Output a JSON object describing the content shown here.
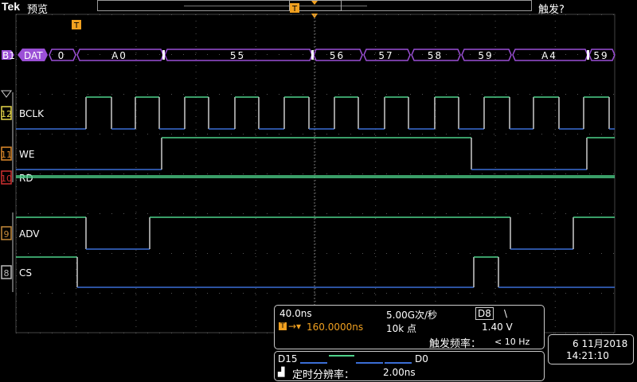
{
  "header": {
    "brand": "Tek",
    "mode": "预览",
    "trigger_status": "触发?",
    "trigger_marker": "T"
  },
  "bus": {
    "id": "B1",
    "label": "DAT",
    "symbols": [
      "0",
      "A0",
      "55",
      "56",
      "57",
      "58",
      "59",
      "A4",
      "59"
    ]
  },
  "channels": [
    {
      "num": "12",
      "name": "BCLK",
      "color": "#e8d84a"
    },
    {
      "num": "11",
      "name": "WE",
      "color": "#e08a2a"
    },
    {
      "num": "10",
      "name": "RD",
      "color": "#d03030"
    },
    {
      "num": "9",
      "name": "ADV",
      "color": "#c58a3a"
    },
    {
      "num": "8",
      "name": "CS",
      "color": "#bbbbbb"
    }
  ],
  "acquisition": {
    "time_per_div": "40.0ns",
    "sample_rate": "5.00G次/秒",
    "trig_source": "D8",
    "trig_slope": "\\",
    "trig_position": "160.0000ns",
    "record_length": "10k 点",
    "trig_level": "1.40 V",
    "trig_freq_label": "触发频率：",
    "trig_freq_value": "< 10 Hz"
  },
  "digital": {
    "high": "D15",
    "low": "D0",
    "resolution_label": "定时分辨率：",
    "resolution_value": "2.00ns"
  },
  "clock": {
    "date": "6 11月2018",
    "time": "14:21:10"
  },
  "colors": {
    "high_level": "#4ed28a",
    "low_level": "#3b6ed6",
    "bus": "#9b4fd6",
    "trigger": "#f0a020"
  }
}
